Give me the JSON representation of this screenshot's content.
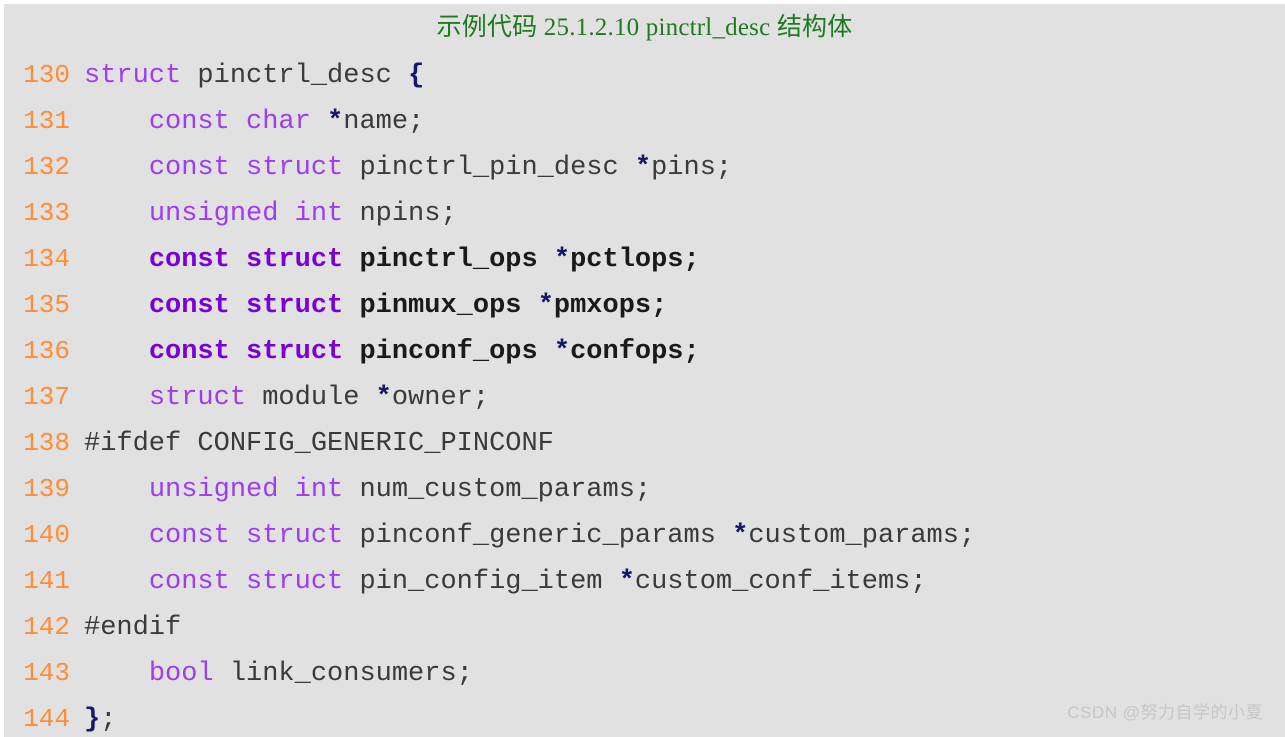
{
  "caption": {
    "prefix_cjk": "示例代码",
    "number": "25.1.2.10",
    "symbol": "pinctrl_desc",
    "suffix_cjk": "结构体",
    "full": "示例代码 25.1.2.10 pinctrl_desc 结构体",
    "color": "#1f7a1f"
  },
  "theme": {
    "background": "#e1e1e1",
    "page_background": "#ffffff",
    "lineno_color": "#ff8c37",
    "keyword_color": "#9d3cf0",
    "keyword_bold_color": "#7a00d6",
    "identifier_color": "#3a3a3a",
    "pointer_color": "#16166e",
    "watermark_color": "#c6c6c6"
  },
  "code": {
    "language": "c",
    "first_line": 130,
    "last_line": 144,
    "lines": [
      {
        "number": "130",
        "bold": false,
        "text": "struct pinctrl_desc {",
        "tokens": [
          {
            "t": "struct",
            "c": "kw"
          },
          {
            "t": " ",
            "c": "punct"
          },
          {
            "t": "pinctrl_desc",
            "c": "id"
          },
          {
            "t": " ",
            "c": "punct"
          },
          {
            "t": "{",
            "c": "brace"
          }
        ]
      },
      {
        "number": "131",
        "bold": false,
        "text": "    const char *name;",
        "tokens": [
          {
            "t": "    ",
            "c": "punct"
          },
          {
            "t": "const",
            "c": "kw"
          },
          {
            "t": " ",
            "c": "punct"
          },
          {
            "t": "char",
            "c": "kw"
          },
          {
            "t": " ",
            "c": "punct"
          },
          {
            "t": "*",
            "c": "star"
          },
          {
            "t": "name;",
            "c": "id"
          }
        ]
      },
      {
        "number": "132",
        "bold": false,
        "text": "    const struct pinctrl_pin_desc *pins;",
        "tokens": [
          {
            "t": "    ",
            "c": "punct"
          },
          {
            "t": "const",
            "c": "kw"
          },
          {
            "t": " ",
            "c": "punct"
          },
          {
            "t": "struct",
            "c": "kw"
          },
          {
            "t": " ",
            "c": "punct"
          },
          {
            "t": "pinctrl_pin_desc",
            "c": "id"
          },
          {
            "t": " ",
            "c": "punct"
          },
          {
            "t": "*",
            "c": "star"
          },
          {
            "t": "pins;",
            "c": "id"
          }
        ]
      },
      {
        "number": "133",
        "bold": false,
        "text": "    unsigned int npins;",
        "tokens": [
          {
            "t": "    ",
            "c": "punct"
          },
          {
            "t": "unsigned",
            "c": "kw"
          },
          {
            "t": " ",
            "c": "punct"
          },
          {
            "t": "int",
            "c": "kw"
          },
          {
            "t": " ",
            "c": "punct"
          },
          {
            "t": "npins;",
            "c": "id"
          }
        ]
      },
      {
        "number": "134",
        "bold": true,
        "text": "    const struct pinctrl_ops *pctlops;",
        "tokens": [
          {
            "t": "    ",
            "c": "punct"
          },
          {
            "t": "const",
            "c": "kw"
          },
          {
            "t": " ",
            "c": "punct"
          },
          {
            "t": "struct",
            "c": "kw"
          },
          {
            "t": " ",
            "c": "punct"
          },
          {
            "t": "pinctrl_ops",
            "c": "id"
          },
          {
            "t": " ",
            "c": "punct"
          },
          {
            "t": "*",
            "c": "star"
          },
          {
            "t": "pctlops;",
            "c": "id"
          }
        ]
      },
      {
        "number": "135",
        "bold": true,
        "text": "    const struct pinmux_ops *pmxops;",
        "tokens": [
          {
            "t": "    ",
            "c": "punct"
          },
          {
            "t": "const",
            "c": "kw"
          },
          {
            "t": " ",
            "c": "punct"
          },
          {
            "t": "struct",
            "c": "kw"
          },
          {
            "t": " ",
            "c": "punct"
          },
          {
            "t": "pinmux_ops",
            "c": "id"
          },
          {
            "t": " ",
            "c": "punct"
          },
          {
            "t": "*",
            "c": "star"
          },
          {
            "t": "pmxops;",
            "c": "id"
          }
        ]
      },
      {
        "number": "136",
        "bold": true,
        "text": "    const struct pinconf_ops *confops;",
        "tokens": [
          {
            "t": "    ",
            "c": "punct"
          },
          {
            "t": "const",
            "c": "kw"
          },
          {
            "t": " ",
            "c": "punct"
          },
          {
            "t": "struct",
            "c": "kw"
          },
          {
            "t": " ",
            "c": "punct"
          },
          {
            "t": "pinconf_ops",
            "c": "id"
          },
          {
            "t": " ",
            "c": "punct"
          },
          {
            "t": "*",
            "c": "star"
          },
          {
            "t": "confops;",
            "c": "id"
          }
        ]
      },
      {
        "number": "137",
        "bold": false,
        "text": "    struct module *owner;",
        "tokens": [
          {
            "t": "    ",
            "c": "punct"
          },
          {
            "t": "struct",
            "c": "kw"
          },
          {
            "t": " ",
            "c": "punct"
          },
          {
            "t": "module",
            "c": "id"
          },
          {
            "t": " ",
            "c": "punct"
          },
          {
            "t": "*",
            "c": "star"
          },
          {
            "t": "owner;",
            "c": "id"
          }
        ]
      },
      {
        "number": "138",
        "bold": false,
        "text": "#ifdef CONFIG_GENERIC_PINCONF",
        "tokens": [
          {
            "t": "#ifdef CONFIG_GENERIC_PINCONF",
            "c": "pp"
          }
        ]
      },
      {
        "number": "139",
        "bold": false,
        "text": "    unsigned int num_custom_params;",
        "tokens": [
          {
            "t": "    ",
            "c": "punct"
          },
          {
            "t": "unsigned",
            "c": "kw"
          },
          {
            "t": " ",
            "c": "punct"
          },
          {
            "t": "int",
            "c": "kw"
          },
          {
            "t": " ",
            "c": "punct"
          },
          {
            "t": "num_custom_params;",
            "c": "id"
          }
        ]
      },
      {
        "number": "140",
        "bold": false,
        "text": "    const struct pinconf_generic_params *custom_params;",
        "tokens": [
          {
            "t": "    ",
            "c": "punct"
          },
          {
            "t": "const",
            "c": "kw"
          },
          {
            "t": " ",
            "c": "punct"
          },
          {
            "t": "struct",
            "c": "kw"
          },
          {
            "t": " ",
            "c": "punct"
          },
          {
            "t": "pinconf_generic_params",
            "c": "id"
          },
          {
            "t": " ",
            "c": "punct"
          },
          {
            "t": "*",
            "c": "star"
          },
          {
            "t": "custom_params;",
            "c": "id"
          }
        ]
      },
      {
        "number": "141",
        "bold": false,
        "text": "    const struct pin_config_item *custom_conf_items;",
        "tokens": [
          {
            "t": "    ",
            "c": "punct"
          },
          {
            "t": "const",
            "c": "kw"
          },
          {
            "t": " ",
            "c": "punct"
          },
          {
            "t": "struct",
            "c": "kw"
          },
          {
            "t": " ",
            "c": "punct"
          },
          {
            "t": "pin_config_item",
            "c": "id"
          },
          {
            "t": " ",
            "c": "punct"
          },
          {
            "t": "*",
            "c": "star"
          },
          {
            "t": "custom_conf_items;",
            "c": "id"
          }
        ]
      },
      {
        "number": "142",
        "bold": false,
        "text": "#endif",
        "tokens": [
          {
            "t": "#endif",
            "c": "pp"
          }
        ]
      },
      {
        "number": "143",
        "bold": false,
        "text": "    bool link_consumers;",
        "tokens": [
          {
            "t": "    ",
            "c": "punct"
          },
          {
            "t": "bool",
            "c": "kw"
          },
          {
            "t": " ",
            "c": "punct"
          },
          {
            "t": "link_consumers;",
            "c": "id"
          }
        ]
      },
      {
        "number": "144",
        "bold": false,
        "text": "};",
        "tokens": [
          {
            "t": "}",
            "c": "brace"
          },
          {
            "t": ";",
            "c": "punct"
          }
        ]
      }
    ]
  },
  "watermark": {
    "text": "CSDN @努力自学的小夏"
  }
}
